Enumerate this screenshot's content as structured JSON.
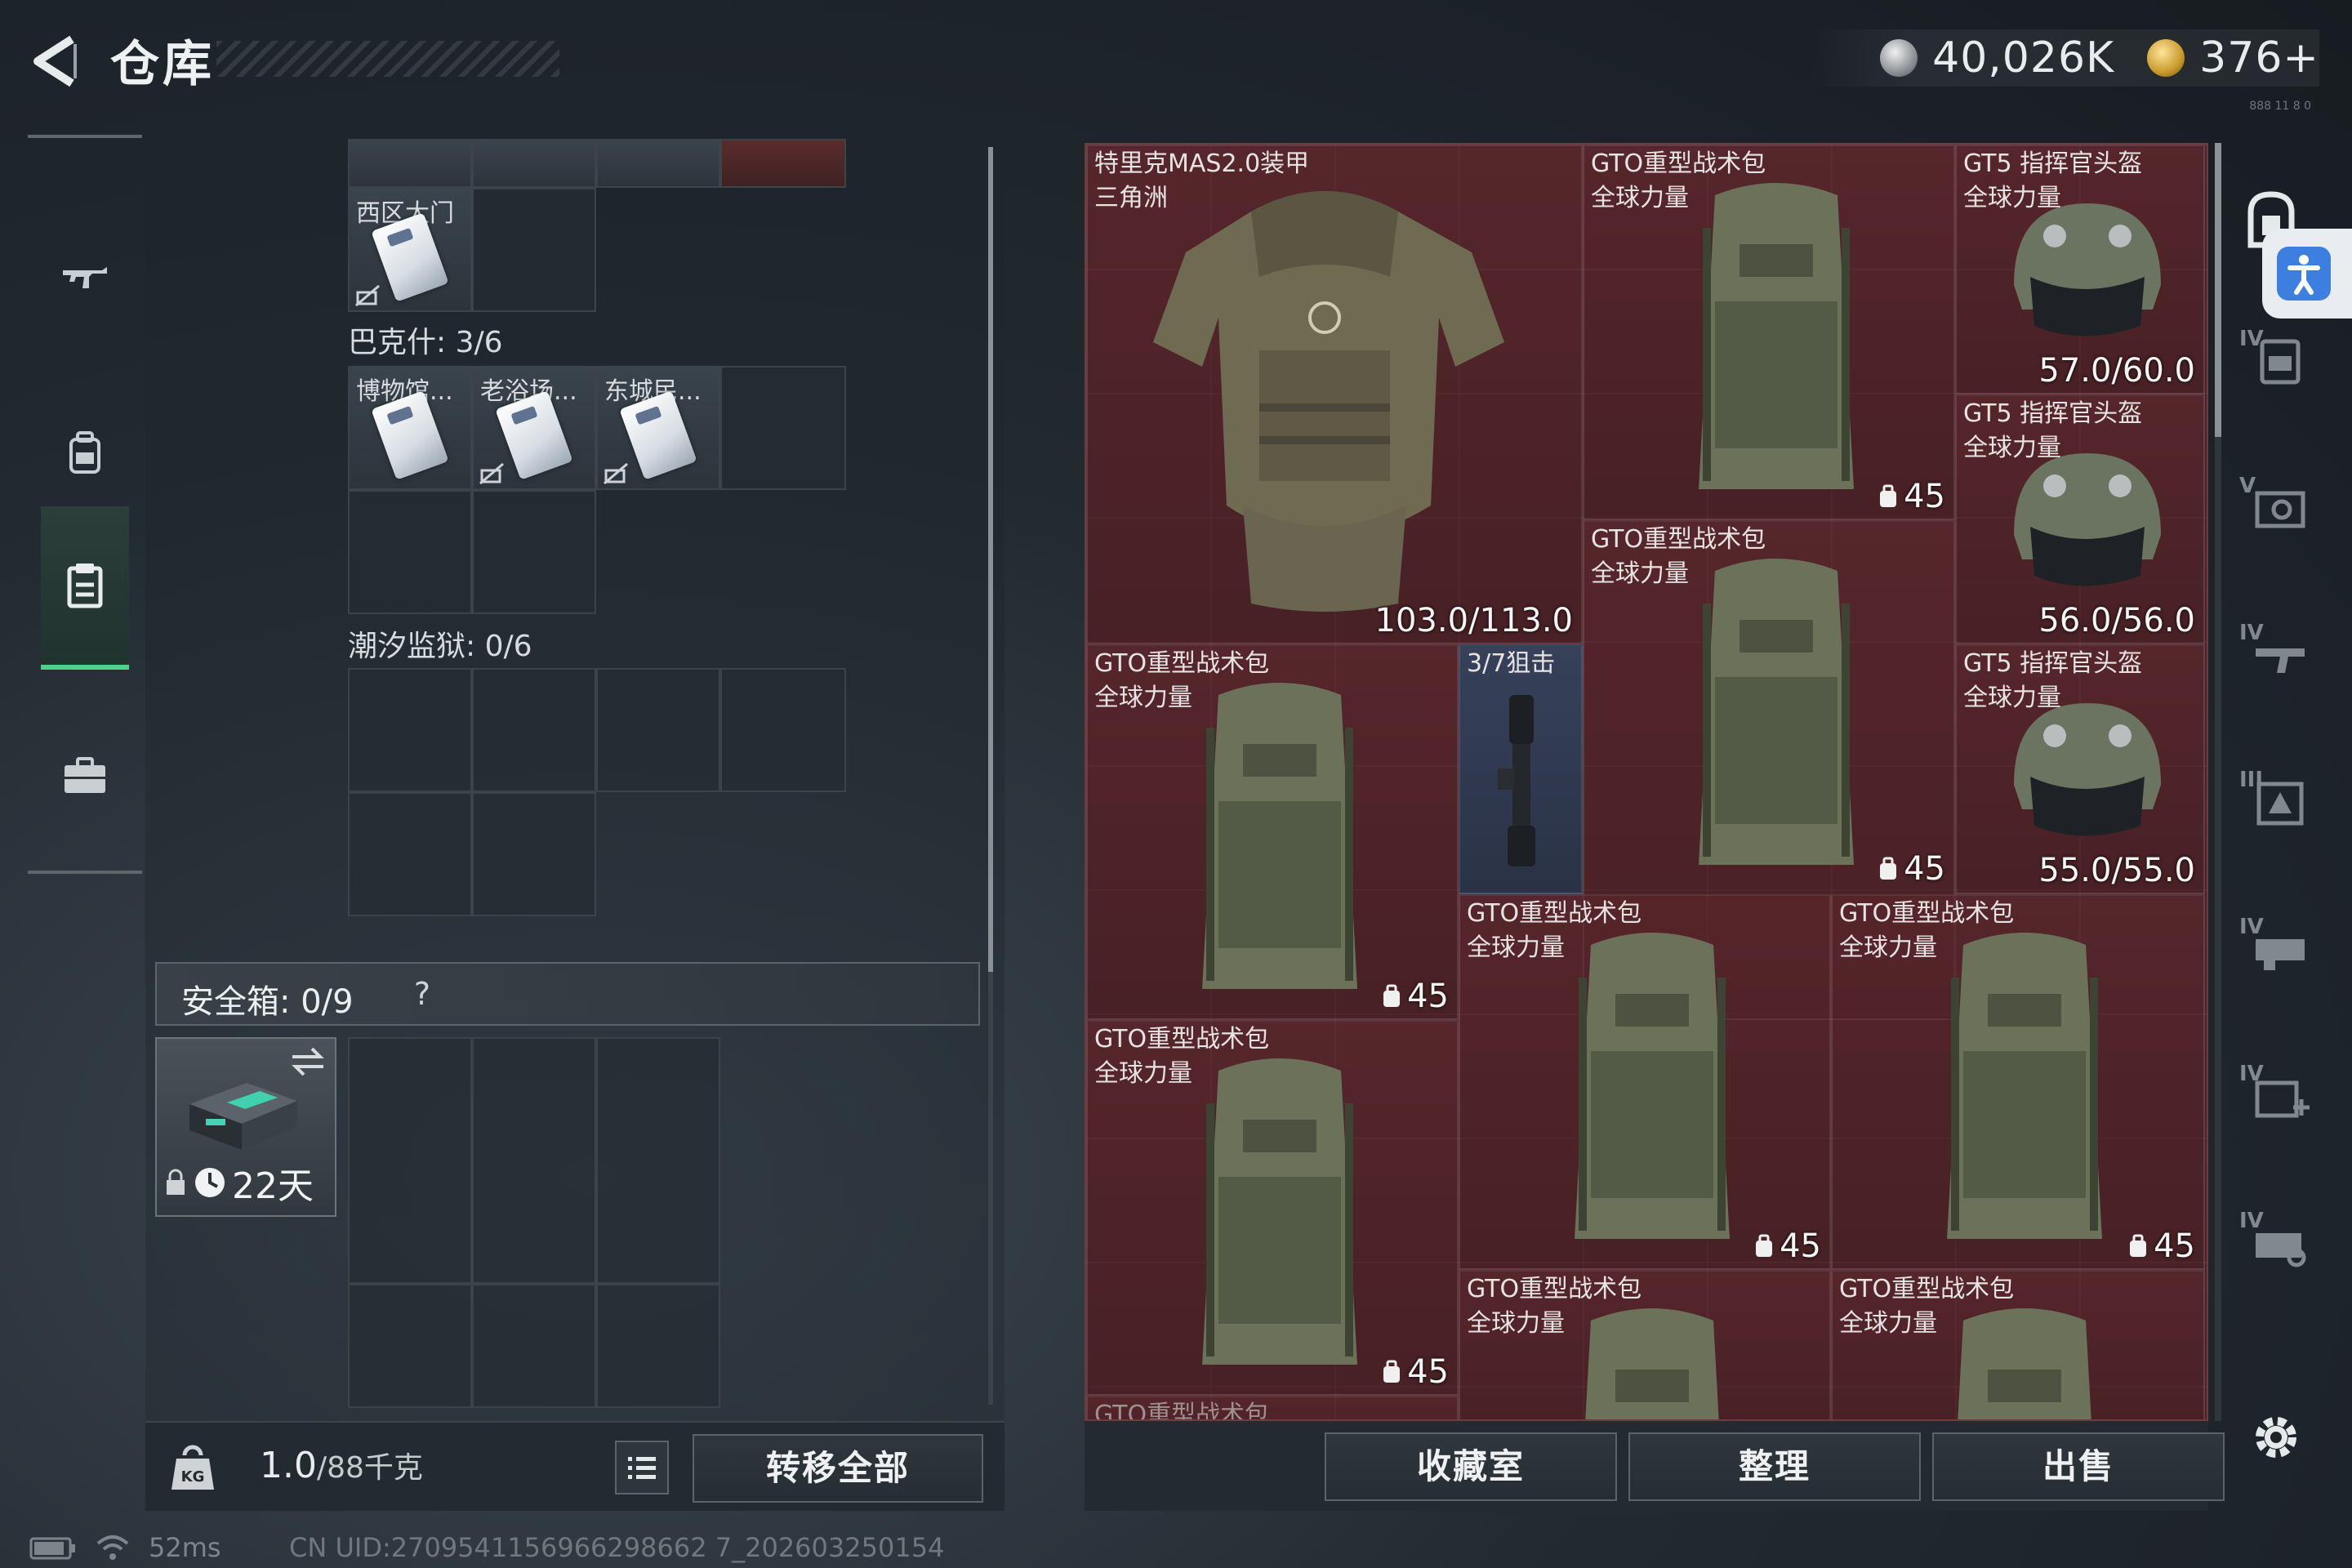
{
  "header": {
    "title": "仓库",
    "silver_amount": "40,026K",
    "gold_amount": "376+",
    "hint": "888 11 8 0"
  },
  "nav": {
    "items": [
      {
        "name": "weapons",
        "icon": "rifle-icon"
      },
      {
        "name": "equipment",
        "icon": "backpack-icon"
      },
      {
        "name": "inventory",
        "icon": "clipboard-icon",
        "active": true
      },
      {
        "name": "items",
        "icon": "briefcase-icon"
      }
    ]
  },
  "stash": {
    "top_row_labels": [
      "",
      "",
      "",
      ""
    ],
    "card_west_gate": "西区大门",
    "section_bakshi": "巴克什: 3/6",
    "bakshi_cards": [
      "博物馆...",
      "老浴场...",
      "东城民..."
    ],
    "section_tidal": "潮汐监狱: 0/6",
    "safe_box_label": "安全箱: 0/9",
    "help": "?",
    "safe_box_timer": "22天",
    "weight": "1.0",
    "weight_unit": "/88千克",
    "transfer_all": "转移全部"
  },
  "inventory": {
    "armor": {
      "name": "特里克MAS2.0装甲",
      "sub": "三角洲",
      "durability": "103.0/113.0"
    },
    "helmets": [
      {
        "name": "GT5 指挥官头盔",
        "sub": "全球力量",
        "durability": "57.0/60.0"
      },
      {
        "name": "GT5 指挥官头盔",
        "sub": "全球力量",
        "durability": "56.0/56.0"
      },
      {
        "name": "GT5 指挥官头盔",
        "sub": "全球力量",
        "durability": "55.0/55.0"
      }
    ],
    "scope": {
      "name": "3/7狙击"
    },
    "bags": [
      {
        "name": "GTO重型战术包",
        "sub": "全球力量",
        "capacity": "45"
      },
      {
        "name": "GTO重型战术包",
        "sub": "全球力量",
        "capacity": "45"
      },
      {
        "name": "GTO重型战术包",
        "sub": "全球力量",
        "capacity": "45"
      },
      {
        "name": "GTO重型战术包",
        "sub": "全球力量",
        "capacity": "45"
      },
      {
        "name": "GTO重型战术包",
        "sub": "全球力量",
        "capacity": "45"
      },
      {
        "name": "GTO重型战术包",
        "sub": "全球力量",
        "capacity": "45"
      },
      {
        "name": "GTO重型战术包",
        "sub": "全球力量",
        "capacity": ""
      },
      {
        "name": "GTO重型战术包",
        "sub": "全球力量",
        "capacity": ""
      },
      {
        "name": "GTO重型战术包",
        "sub": "",
        "capacity": ""
      }
    ],
    "buttons": {
      "collection": "收藏室",
      "organize": "整理",
      "sell": "出售"
    }
  },
  "rail": {
    "tiers": [
      "IV",
      "V",
      "IV",
      "III",
      "IV",
      "IV",
      "IV"
    ]
  },
  "status": {
    "ping": "52ms",
    "uid": "CN UID:2709541156966298662 7_202603250154"
  },
  "colors": {
    "accent_green": "#4fd08b",
    "inventory_red": "#4a2428",
    "a11y_blue": "#3d7fe0"
  }
}
